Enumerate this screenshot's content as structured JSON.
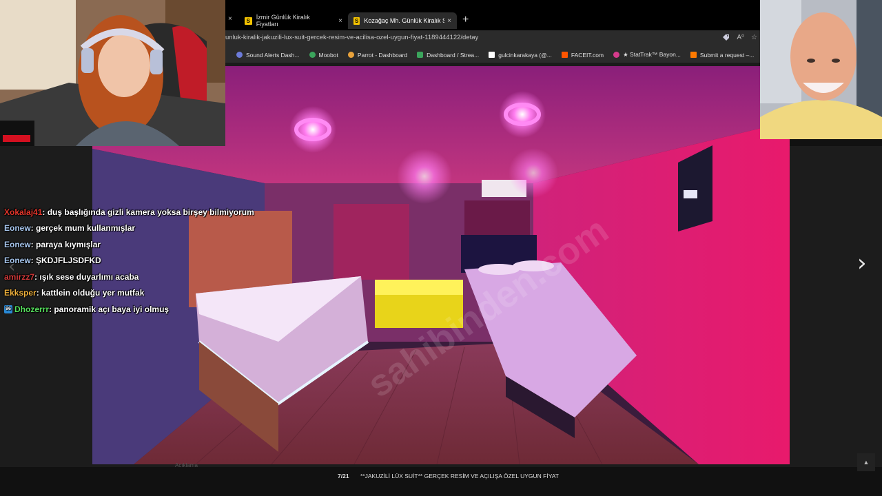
{
  "browser": {
    "tabs": [
      {
        "label": "İzmir Günlük Kiralık Fiyatları",
        "favicon": "S",
        "active": false
      },
      {
        "label": "Kozağaç Mh. Günlük Kiralık Stüdy",
        "favicon": "S",
        "active": true
      }
    ],
    "close_glyph": "×",
    "new_tab_glyph": "+",
    "url": "unluk-kiralik-jakuzili-lux-suit-gercek-resim-ve-acilisa-ozel-uygun-fiyat-1189444122/detay",
    "address_icons": [
      "tag-icon",
      "read-aloud-icon",
      "star-icon"
    ],
    "read_aloud_text": "A⁰",
    "bookmarks": [
      {
        "label": "Sound Alerts Dash...",
        "color": "#6c7bd9"
      },
      {
        "label": "Moobot",
        "color": "#3ba55c"
      },
      {
        "label": "Parrot - Dashboard",
        "color": "#e9a23b"
      },
      {
        "label": "Dashboard / Strea...",
        "color": "#3ba55c"
      },
      {
        "label": "gulcinkarakaya (@...",
        "color": "#ffffff"
      },
      {
        "label": "FACEIT.com",
        "color": "#ff5500"
      },
      {
        "label": "★ StatTrak™ Bayon...",
        "color": "#d53b8c"
      },
      {
        "label": "Submit a request –...",
        "color": "#ff7a00"
      }
    ]
  },
  "viewer": {
    "page_index": "7/21",
    "caption": "**JAKUZİLİ LÜX SUİT** GERÇEK RESİM VE AÇILIŞA ÖZEL UYGUN FİYAT",
    "description_label": "Açıklama",
    "next_glyph": "›",
    "prev_glyph": "‹",
    "scroll_top_glyph": "▲",
    "watermark": "sahibinden.com"
  },
  "chat": [
    {
      "user": "Xokalaj41",
      "color": "#e3352b",
      "text": " : duş başlığında gizli kamera yoksa birşey bilmiyorum",
      "badge": ""
    },
    {
      "user": "Eonew",
      "color": "#a8c7ef",
      "text": " : gerçek mum kullanmışlar",
      "badge": ""
    },
    {
      "user": "Eonew",
      "color": "#a8c7ef",
      "text": " : paraya kıymışlar",
      "badge": ""
    },
    {
      "user": "Eonew",
      "color": "#a8c7ef",
      "text": " : ŞKDJFLJSDFKD",
      "badge": ""
    },
    {
      "user": "amirzz7",
      "color": "#d43a3a",
      "text": " : ışık sese duyarlımı acaba",
      "badge": ""
    },
    {
      "user": "Ekksper",
      "color": "#f0b13c",
      "text": " : kattlein olduğu yer mutfak",
      "badge": ""
    },
    {
      "user": "Dhozerrr",
      "color": "#56e05d",
      "text": " : panoramik açı baya iyi olmuş",
      "badge": "96"
    }
  ],
  "colors": {
    "accent_pink": "#e8187a",
    "chrome_dark": "#2b2b2b",
    "tab_favicon": "#f5c400"
  }
}
